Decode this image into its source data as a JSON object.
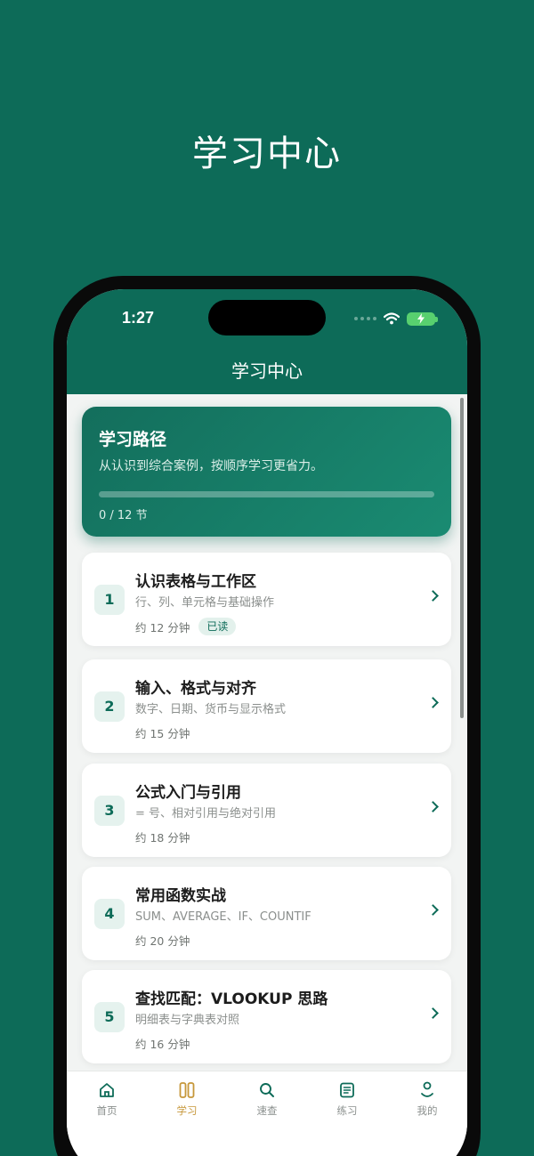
{
  "hero": {
    "title": "学习中心"
  },
  "status": {
    "time": "1:27"
  },
  "nav": {
    "title": "学习中心"
  },
  "path_card": {
    "title": "学习路径",
    "subtitle": "从认识到综合案例，按顺序学习更省力。",
    "progress_text": "0 / 12 节",
    "progress_fraction": 0
  },
  "lessons": [
    {
      "num": "1",
      "title": "认识表格与工作区",
      "desc": "行、列、单元格与基础操作",
      "time": "约 12 分钟",
      "badge": "已读"
    },
    {
      "num": "2",
      "title": "输入、格式与对齐",
      "desc": "数字、日期、货币与显示格式",
      "time": "约 15 分钟"
    },
    {
      "num": "3",
      "title": "公式入门与引用",
      "desc": "= 号、相对引用与绝对引用",
      "time": "约 18 分钟"
    },
    {
      "num": "4",
      "title": "常用函数实战",
      "desc": "SUM、AVERAGE、IF、COUNTIF",
      "time": "约 20 分钟"
    },
    {
      "num": "5",
      "title": "查找匹配：VLOOKUP 思路",
      "desc": "明细表与字典表对照",
      "time": "约 16 分钟"
    }
  ],
  "tabs": [
    {
      "label": "首页",
      "icon": "home-icon"
    },
    {
      "label": "学习",
      "icon": "book-icon",
      "active": true
    },
    {
      "label": "速查",
      "icon": "search-icon"
    },
    {
      "label": "练习",
      "icon": "notes-icon"
    },
    {
      "label": "我的",
      "icon": "profile-icon"
    }
  ],
  "colors": {
    "brand": "#0d6b58",
    "accent": "#c6973a",
    "battery": "#58d06f"
  }
}
